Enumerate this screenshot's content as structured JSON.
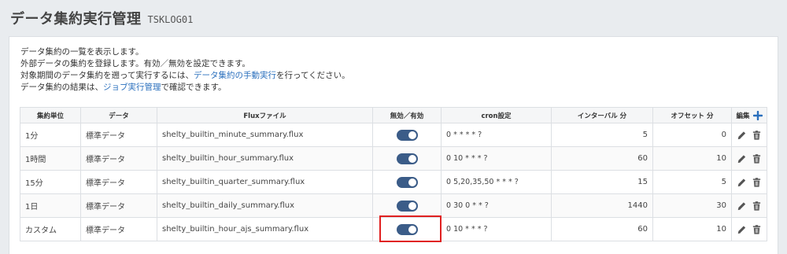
{
  "header": {
    "title": "データ集約実行管理",
    "code": "TSKLOG01"
  },
  "description": {
    "line1": "データ集約の一覧を表示します。",
    "line2": "外部データの集約を登録します。有効／無効を設定できます。",
    "line3_pre": "対象期間のデータ集約を遡って実行するには、",
    "line3_link": "データ集約の手動実行",
    "line3_post": "を行ってください。",
    "line4_pre": "データ集約の結果は、",
    "line4_link": "ジョブ実行管理",
    "line4_post": "で確認できます。"
  },
  "table": {
    "headers": {
      "unit": "集約単位",
      "data": "データ",
      "flux": "Fluxファイル",
      "enabled": "無効／有効",
      "cron": "cron設定",
      "interval": "インターバル 分",
      "offset": "オフセット 分",
      "edit": "編集"
    },
    "rows": [
      {
        "unit": "1分",
        "data": "標準データ",
        "flux": "shelty_builtin_minute_summary.flux",
        "enabled": true,
        "cron": "0 * * * * ?",
        "interval": "5",
        "offset": "0"
      },
      {
        "unit": "1時間",
        "data": "標準データ",
        "flux": "shelty_builtin_hour_summary.flux",
        "enabled": true,
        "cron": "0 10 * * * ?",
        "interval": "60",
        "offset": "10"
      },
      {
        "unit": "15分",
        "data": "標準データ",
        "flux": "shelty_builtin_quarter_summary.flux",
        "enabled": true,
        "cron": "0 5,20,35,50 * * * ?",
        "interval": "15",
        "offset": "5"
      },
      {
        "unit": "1日",
        "data": "標準データ",
        "flux": "shelty_builtin_daily_summary.flux",
        "enabled": true,
        "cron": "0 30 0 * * ?",
        "interval": "1440",
        "offset": "30"
      },
      {
        "unit": "カスタム",
        "data": "標準データ",
        "flux": "shelty_builtin_hour_ajs_summary.flux",
        "enabled": true,
        "cron": "0 10 * * * ?",
        "interval": "60",
        "offset": "10"
      }
    ]
  },
  "icons": {
    "add": "plus-icon",
    "edit": "pencil-icon",
    "delete": "trash-icon"
  },
  "colors": {
    "link": "#2a6fbd",
    "toggle_on": "#3b5c88",
    "add_icon": "#2a6fbd",
    "highlight": "#e02020"
  }
}
